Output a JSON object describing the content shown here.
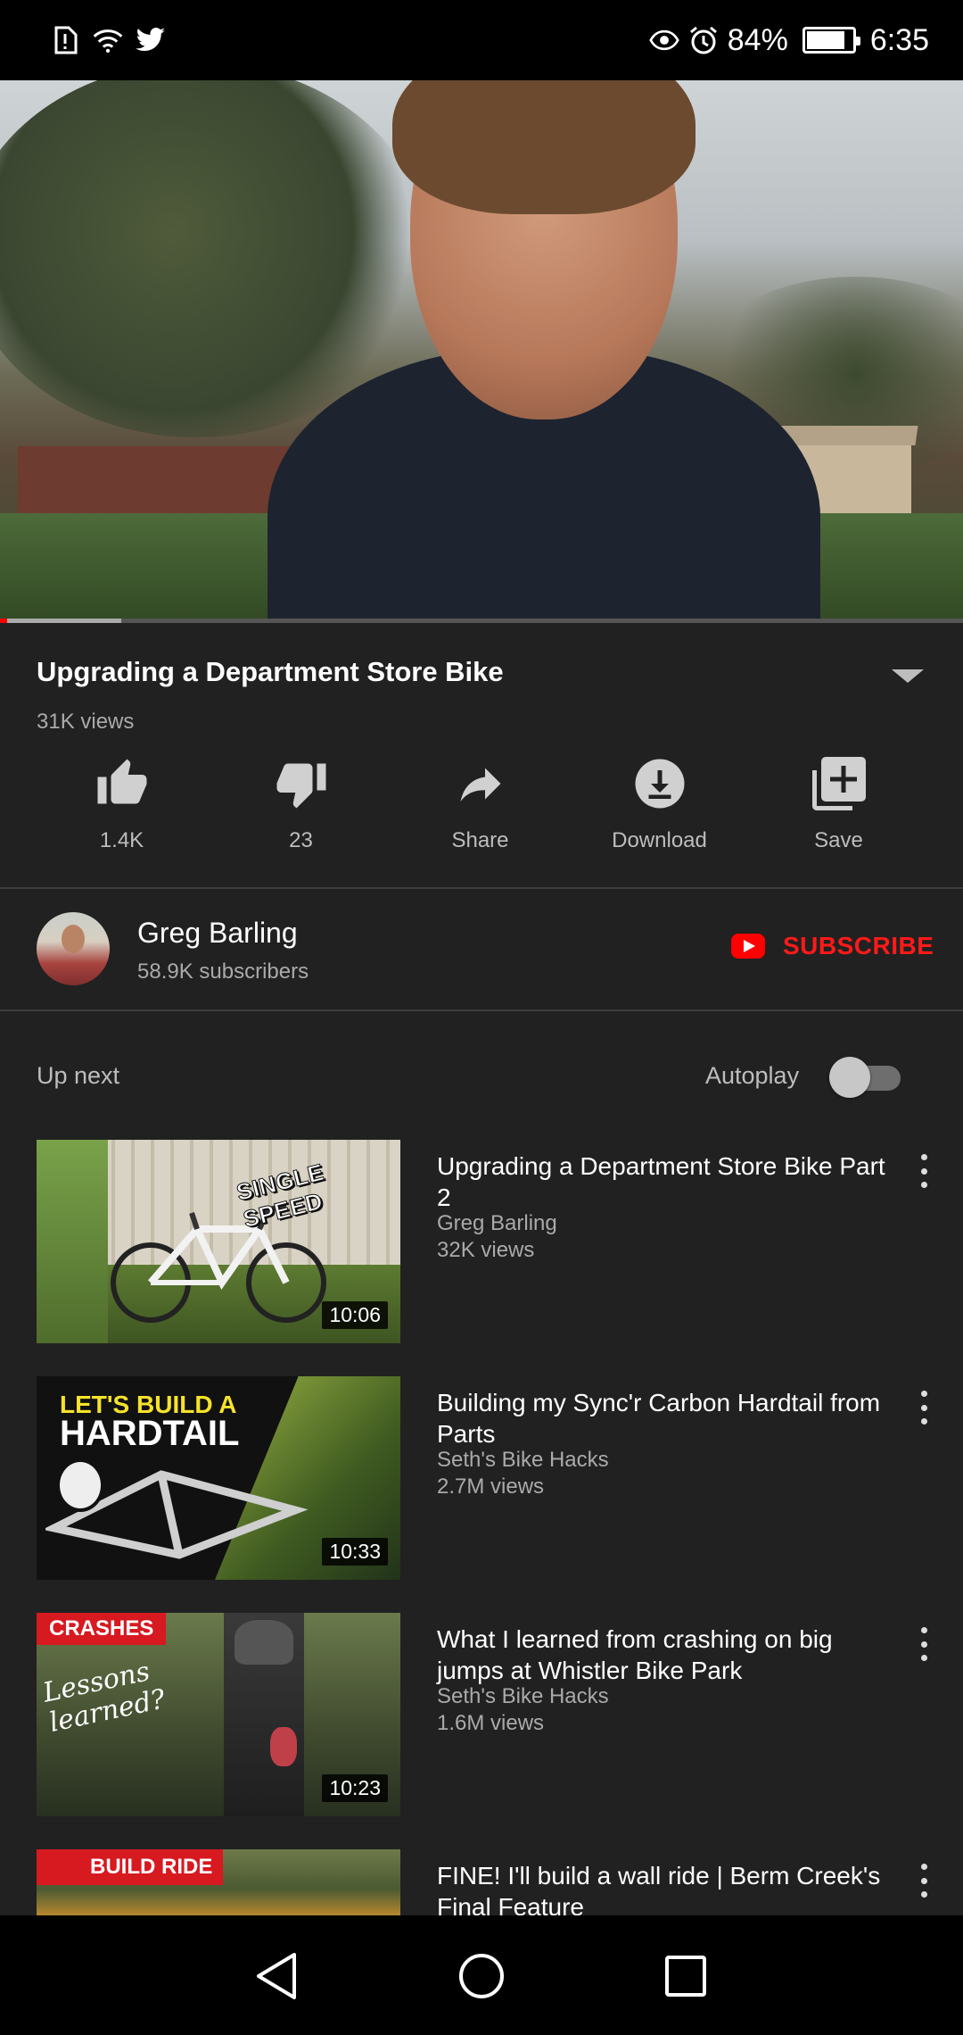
{
  "status_bar": {
    "left_icons": [
      "alert-icon",
      "wifi-icon",
      "twitter-icon"
    ],
    "right_icons": [
      "eye-icon",
      "alarm-icon"
    ],
    "battery_text": "84%",
    "battery_level": 0.84,
    "time": "6:35"
  },
  "player": {
    "progress_fraction": 0.004,
    "buffered_fraction": 0.126
  },
  "video": {
    "title": "Upgrading a Department Store Bike",
    "views": "31K views"
  },
  "actions": [
    {
      "label": "1.4K",
      "icon": "thumbs-up-icon"
    },
    {
      "label": "23",
      "icon": "thumbs-down-icon"
    },
    {
      "label": "Share",
      "icon": "share-icon"
    },
    {
      "label": "Download",
      "icon": "download-icon"
    },
    {
      "label": "Save",
      "icon": "add-to-playlist-icon"
    }
  ],
  "channel": {
    "name": "Greg Barling",
    "subscribers": "58.9K subscribers",
    "subscribe_label": "SUBSCRIBE"
  },
  "up_next": {
    "label": "Up next",
    "autoplay_label": "Autoplay",
    "autoplay_on": false
  },
  "videos": [
    {
      "title": "Upgrading a Department Store Bike Part 2",
      "channel": "Greg Barling",
      "views": "32K views",
      "duration": "10:06",
      "thumb_text": "SINGLE SPEED"
    },
    {
      "title": "Building my Sync'r Carbon Hardtail from Parts",
      "channel": "Seth's Bike Hacks",
      "views": "2.7M views",
      "duration": "10:33",
      "thumb_text_1": "LET'S BUILD A",
      "thumb_text_2": "HARDTAIL"
    },
    {
      "title": "What I learned from crashing on big jumps at Whistler Bike Park",
      "channel": "Seth's Bike Hacks",
      "views": "1.6M views",
      "duration": "10:23",
      "thumb_badge": "CRASHES",
      "thumb_script_1": "Lessons",
      "thumb_script_2": "learned?"
    },
    {
      "title": "FINE! I'll build a wall ride | Berm Creek's Final Feature",
      "thumb_badge": "BUILD RIDE"
    }
  ],
  "colors": {
    "background": "#212121",
    "accent_red": "#ff0000",
    "subscribe_red": "#ff1a1a",
    "secondary_text": "#aaaaaa"
  }
}
